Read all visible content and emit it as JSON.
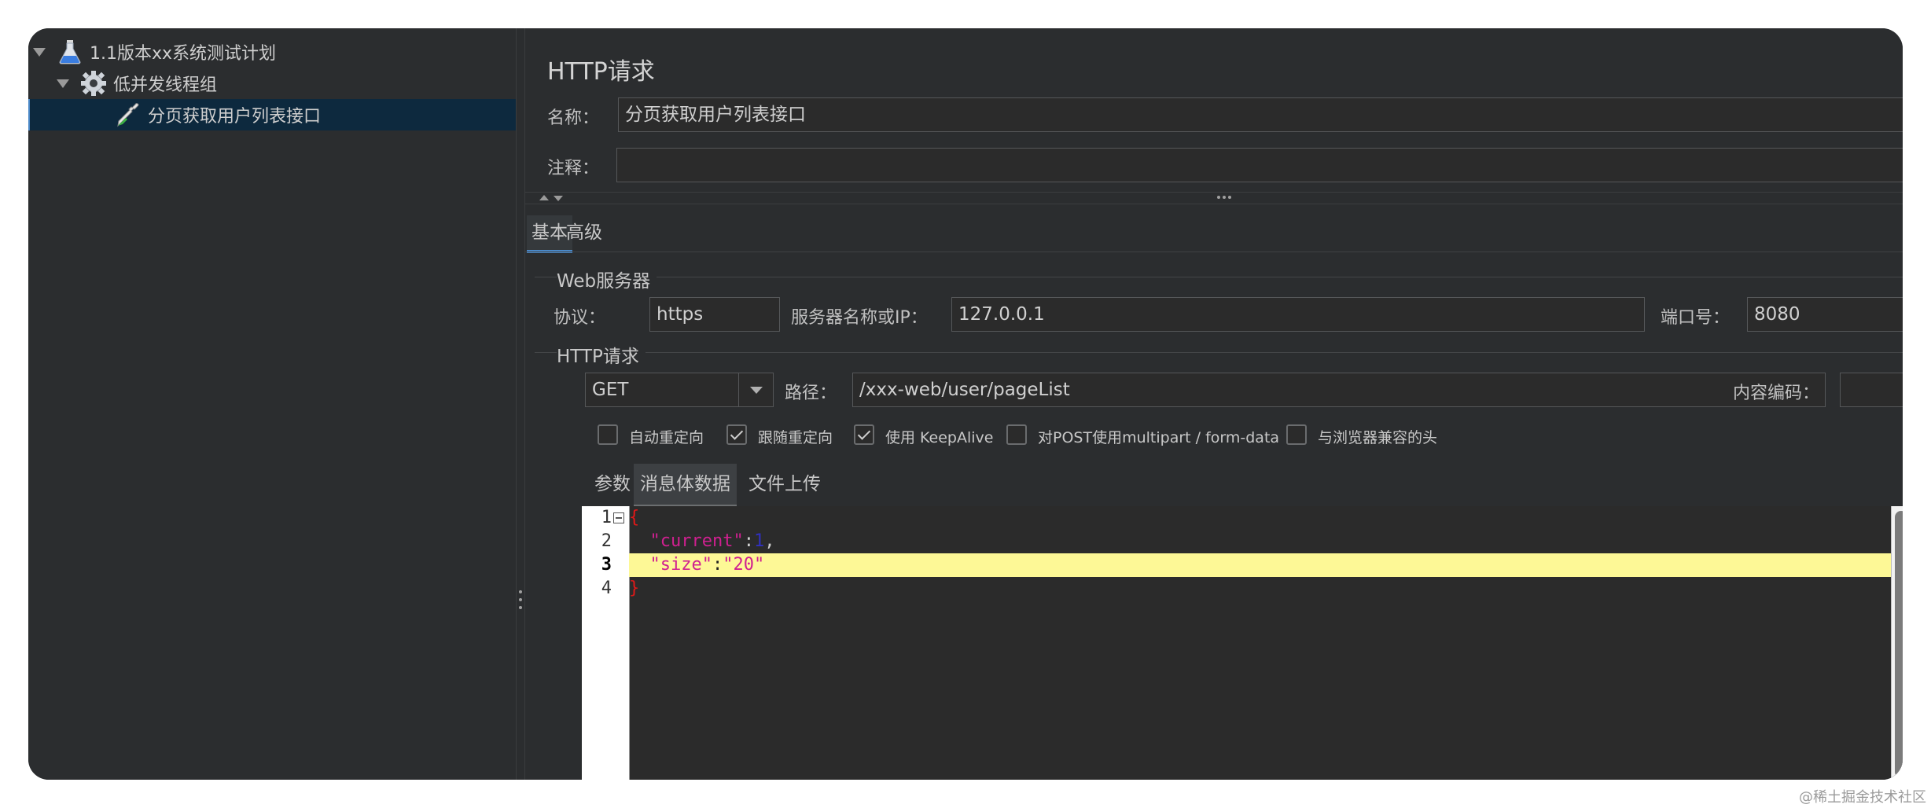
{
  "tree": {
    "items": [
      {
        "label": "1.1版本xx系统测试计划",
        "icon": "flask-icon",
        "expanded": true
      },
      {
        "label": "低并发线程组",
        "icon": "gear-icon",
        "expanded": true
      },
      {
        "label": "分页获取用户列表接口",
        "icon": "pipette-icon",
        "selected": true
      }
    ]
  },
  "panel": {
    "title": "HTTP请求",
    "name_label": "名称：",
    "name_value": "分页获取用户列表接口",
    "comment_label": "注释：",
    "comment_value": ""
  },
  "tabs": [
    {
      "label": "基本",
      "active": true
    },
    {
      "label": "高级",
      "active": false
    }
  ],
  "web_server": {
    "group_title": "Web服务器",
    "protocol_label": "协议：",
    "protocol_value": "https",
    "server_label": "服务器名称或IP：",
    "server_value": "127.0.0.1",
    "port_label": "端口号：",
    "port_value": "8080"
  },
  "http_request": {
    "group_title": "HTTP请求",
    "method_value": "GET",
    "path_label": "路径：",
    "path_value": "/xxx-web/user/pageList",
    "encoding_label": "内容编码：",
    "encoding_value": ""
  },
  "options": [
    {
      "label": "自动重定向",
      "checked": false
    },
    {
      "label": "跟随重定向",
      "checked": true
    },
    {
      "label": "使用 KeepAlive",
      "checked": true
    },
    {
      "label": "对POST使用multipart / form-data",
      "checked": false
    },
    {
      "label": "与浏览器兼容的头",
      "checked": false
    }
  ],
  "subtabs": [
    {
      "label": "参数",
      "active": false
    },
    {
      "label": "消息体数据",
      "active": true
    },
    {
      "label": "文件上传",
      "active": false
    }
  ],
  "editor": {
    "line_numbers": [
      "1",
      "2",
      "3",
      "4"
    ],
    "current_line": 3,
    "lines": {
      "l1_brace": "{",
      "l2_key": "\"current\"",
      "l2_colon": ":",
      "l2_value": "1",
      "l2_comma": ",",
      "l3_key": "\"size\"",
      "l3_colon": ":",
      "l3_value": "\"20\"",
      "l4_brace": "}"
    }
  },
  "watermark": "@稀土掘金技术社区",
  "colors": {
    "background": "#2b2d2f",
    "selection": "#0d293e",
    "accent": "#4a88c7",
    "highlight_line": "#fdf896"
  }
}
